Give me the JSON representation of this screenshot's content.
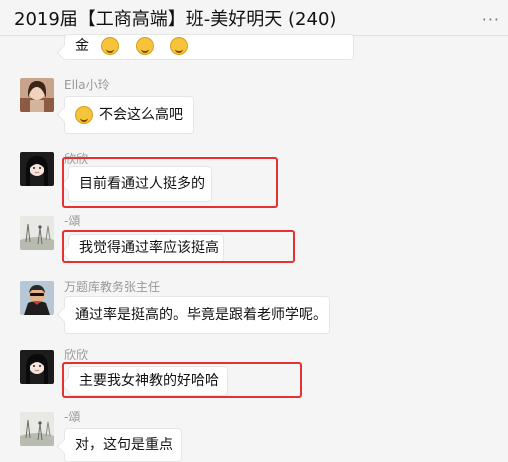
{
  "header": {
    "title": "2019届【工商高端】班-美好明天 (240)",
    "more_icon": "more-dots-icon"
  },
  "messages": [
    {
      "sender": "",
      "text": "金"
    },
    {
      "sender": "Ella小玲",
      "text": "不会这么高吧"
    },
    {
      "sender": "欣欣",
      "text": "目前看通过人挺多的"
    },
    {
      "sender": "-頌",
      "text": "我觉得通过率应该挺高"
    },
    {
      "sender": "万题库教务张主任",
      "text": "通过率是挺高的。毕竟是跟着老师学呢。"
    },
    {
      "sender": "欣欣",
      "text": "主要我女神教的好哈哈"
    },
    {
      "sender": "-頌",
      "text": "对，这句是重点"
    }
  ],
  "colors": {
    "highlight": "#e23232",
    "bubble": "#ffffff",
    "background": "#f5f5f5"
  },
  "icons": [
    "laugh-emoji-icon",
    "laugh-cry-emoji-icon",
    "more-dots-icon"
  ]
}
